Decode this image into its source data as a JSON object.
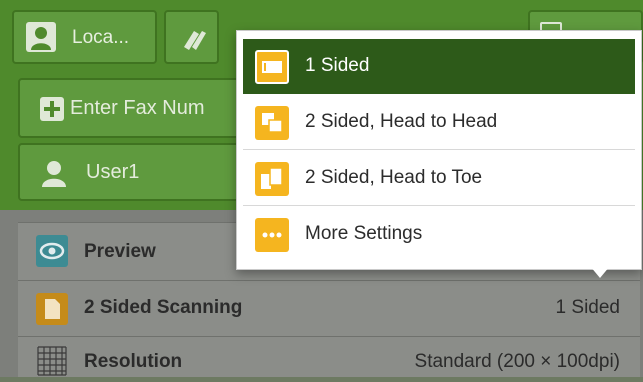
{
  "header": {
    "location_button_label": "Loca...",
    "fax_placeholder": "Enter Fax Num",
    "user_label": "User1"
  },
  "dropdown": {
    "options": [
      {
        "label": "1 Sided",
        "selected": true
      },
      {
        "label": "2 Sided, Head to Head",
        "selected": false
      },
      {
        "label": "2 Sided, Head to Toe",
        "selected": false
      },
      {
        "label": "More Settings",
        "selected": false
      }
    ]
  },
  "settings": {
    "preview_label": "Preview",
    "scanning_label": "2 Sided Scanning",
    "scanning_value": "1 Sided",
    "resolution_label": "Resolution",
    "resolution_value": "Standard (200 × 100dpi)"
  },
  "colors": {
    "header_green": "#4f8a2c",
    "selected_option": "#2d5a19",
    "icon_amber": "#f5b51f"
  }
}
